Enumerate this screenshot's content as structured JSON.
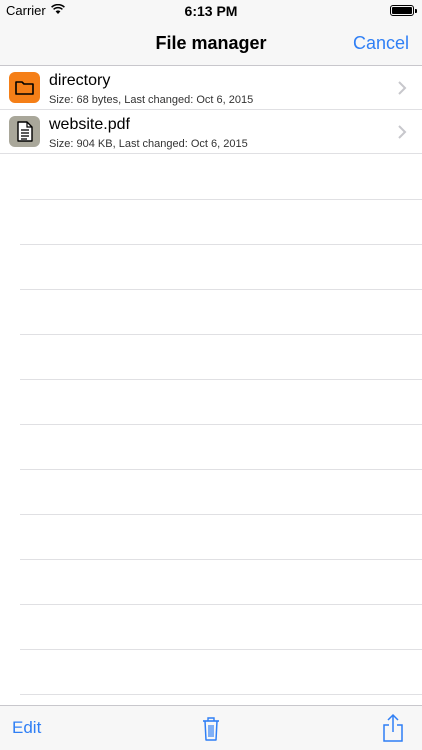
{
  "status_bar": {
    "carrier": "Carrier",
    "time": "6:13 PM",
    "battery_level": 1.0
  },
  "nav_bar": {
    "title": "File manager",
    "cancel_label": "Cancel"
  },
  "files": [
    {
      "name": "directory",
      "meta": "Size: 68 bytes, Last changed: Oct 6, 2015",
      "icon": "folder-icon",
      "icon_color": "#f57f17"
    },
    {
      "name": "website.pdf",
      "meta": "Size: 904 KB, Last changed: Oct 6, 2015",
      "icon": "document-icon",
      "icon_color": "#a9a79a"
    }
  ],
  "toolbar": {
    "edit_label": "Edit",
    "trash_icon": "trash-icon",
    "share_icon": "share-icon"
  },
  "colors": {
    "accent": "#2f7ff5",
    "separator": "#e0e0e3"
  }
}
